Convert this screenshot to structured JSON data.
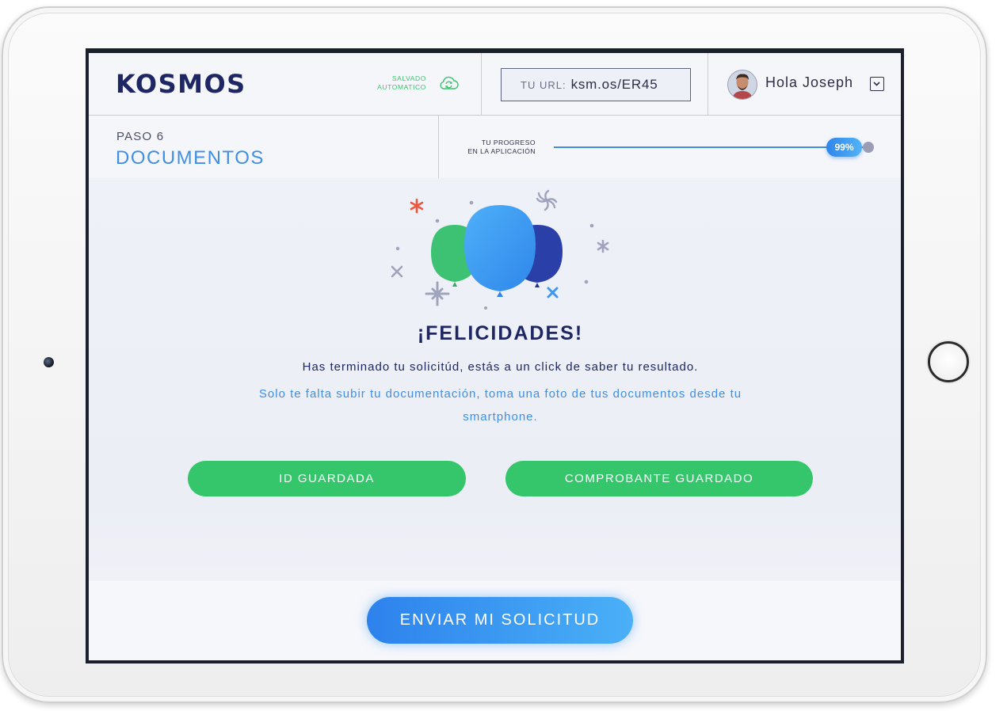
{
  "header": {
    "logo_text": "KOSMOS",
    "autosave_line1": "SALVADO",
    "autosave_line2": "AUTOMATICO",
    "url_label": "TU URL:",
    "url_value": "ksm.os/ER45",
    "greeting": "Hola Joseph"
  },
  "step": {
    "number_label": "PASO 6",
    "title": "DOCUMENTOS",
    "progress_label_line1": "TU PROGRESO",
    "progress_label_line2": "EN LA APLICACIÓN",
    "progress_value": 0.99,
    "progress_text": "99%"
  },
  "main": {
    "heading": "¡FELICIDADES!",
    "message_line1": "Has terminado tu solicitúd, estás a un click de saber tu resultado.",
    "message_line2": "Solo te falta subir tu documentación, toma una foto de tus documentos desde tu smartphone.",
    "buttons": [
      {
        "label": "ID GUARDADA"
      },
      {
        "label": "COMPROBANTE GUARDADO"
      }
    ]
  },
  "footer": {
    "submit_label": "ENVIAR MI SOLICITUD"
  },
  "colors": {
    "navy": "#1e2763",
    "accent_blue": "#3f8fe6",
    "success_green": "#35c66b",
    "balloon_green": "#3cc272",
    "balloon_blue": "#3d98f2",
    "balloon_navy": "#2a3fa8",
    "confetti_red": "#f0563d"
  },
  "icons": {
    "autosave": "cloud-sync-icon",
    "dropdown": "chevron-down-icon",
    "illustration": "balloons-illustration"
  }
}
